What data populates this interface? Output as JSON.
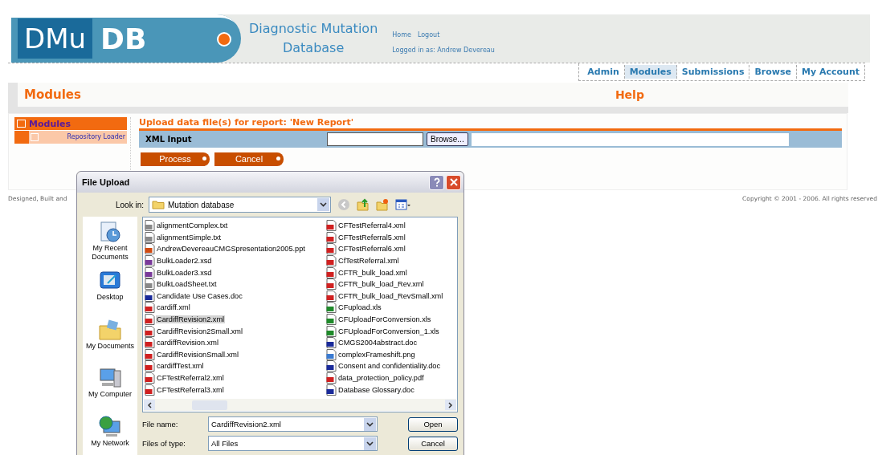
{
  "header": {
    "logo_left": "DMu",
    "logo_right": "DB",
    "title_line1": "Diagnostic Mutation",
    "title_line2": "Database",
    "links": [
      "Home",
      "Logout"
    ],
    "logged_in": "Logged in as: Andrew Devereau"
  },
  "nav": [
    {
      "label": "Admin",
      "selected": false
    },
    {
      "label": "Modules",
      "selected": true
    },
    {
      "label": "Submissions",
      "selected": false
    },
    {
      "label": "Browse",
      "selected": false
    },
    {
      "label": "My Account",
      "selected": false
    }
  ],
  "page_title": "Modules",
  "help": "Help",
  "sidebar": {
    "heading": "Modules",
    "items": [
      {
        "label": "Repository Loader",
        "selected": false
      }
    ]
  },
  "upload": {
    "heading": "Upload data file(s) for report: 'New Report'",
    "field_label": "XML Input",
    "browse": "Browse...",
    "buttons": [
      "Process",
      "Cancel"
    ]
  },
  "footer": {
    "left": "Designed, Built and",
    "right": "Copyright © 2001 - 2006. All rights reserved"
  },
  "dialog": {
    "title": "File Upload",
    "look_in_label": "Look in:",
    "look_in": "Mutation database",
    "places": [
      "My Recent Documents",
      "Desktop",
      "My Documents",
      "My Computer",
      "My Network"
    ],
    "columns": [
      [
        {
          "name": "alignmentComplex.txt",
          "kind": "txt",
          "selected": false
        },
        {
          "name": "alignmentSimple.txt",
          "kind": "txt",
          "selected": false
        },
        {
          "name": "AndrewDevereauCMGSpresentation2005.ppt",
          "kind": "ppt",
          "selected": false
        },
        {
          "name": "BulkLoader2.xsd",
          "kind": "xsd",
          "selected": false
        },
        {
          "name": "BulkLoader3.xsd",
          "kind": "xsd",
          "selected": false
        },
        {
          "name": "BulkLoadSheet.txt",
          "kind": "txt",
          "selected": false
        },
        {
          "name": "Candidate Use Cases.doc",
          "kind": "doc",
          "selected": false
        },
        {
          "name": "cardiff.xml",
          "kind": "xml",
          "selected": false
        },
        {
          "name": "CardiffRevision2.xml",
          "kind": "xml",
          "selected": true
        },
        {
          "name": "CardiffRevision2Small.xml",
          "kind": "xml",
          "selected": false
        },
        {
          "name": "cardiffRevision.xml",
          "kind": "xml",
          "selected": false
        },
        {
          "name": "CardiffRevisionSmall.xml",
          "kind": "xml",
          "selected": false
        },
        {
          "name": "cardiffTest.xml",
          "kind": "xml",
          "selected": false
        },
        {
          "name": "CFTestReferral2.xml",
          "kind": "xml",
          "selected": false
        },
        {
          "name": "CFTestReferral3.xml",
          "kind": "xml",
          "selected": false
        }
      ],
      [
        {
          "name": "CFTestReferral4.xml",
          "kind": "xml",
          "selected": false
        },
        {
          "name": "CFTestReferral5.xml",
          "kind": "xml",
          "selected": false
        },
        {
          "name": "CFTestReferral6.xml",
          "kind": "xml",
          "selected": false
        },
        {
          "name": "CfTestReferral.xml",
          "kind": "xml",
          "selected": false
        },
        {
          "name": "CFTR_bulk_load.xml",
          "kind": "xml",
          "selected": false
        },
        {
          "name": "CFTR_bulk_load_Rev.xml",
          "kind": "xml",
          "selected": false
        },
        {
          "name": "CFTR_bulk_load_RevSmall.xml",
          "kind": "xml",
          "selected": false
        },
        {
          "name": "CFupload.xls",
          "kind": "xls",
          "selected": false
        },
        {
          "name": "CFUploadForConversion.xls",
          "kind": "xls",
          "selected": false
        },
        {
          "name": "CFUploadForConversion_1.xls",
          "kind": "xls",
          "selected": false
        },
        {
          "name": "CMGS2004abstract.doc",
          "kind": "doc",
          "selected": false
        },
        {
          "name": "complexFrameshift.png",
          "kind": "png",
          "selected": false
        },
        {
          "name": "Consent and confidentiality.doc",
          "kind": "doc",
          "selected": false
        },
        {
          "name": "data_protection_policy.pdf",
          "kind": "pdf",
          "selected": false
        },
        {
          "name": "Database Glossary.doc",
          "kind": "doc",
          "selected": false
        }
      ]
    ],
    "file_name_label": "File name:",
    "file_name": "CardiffRevision2.xml",
    "type_label": "Files of type:",
    "type": "All Files",
    "buttons": [
      "Open",
      "Cancel"
    ]
  }
}
